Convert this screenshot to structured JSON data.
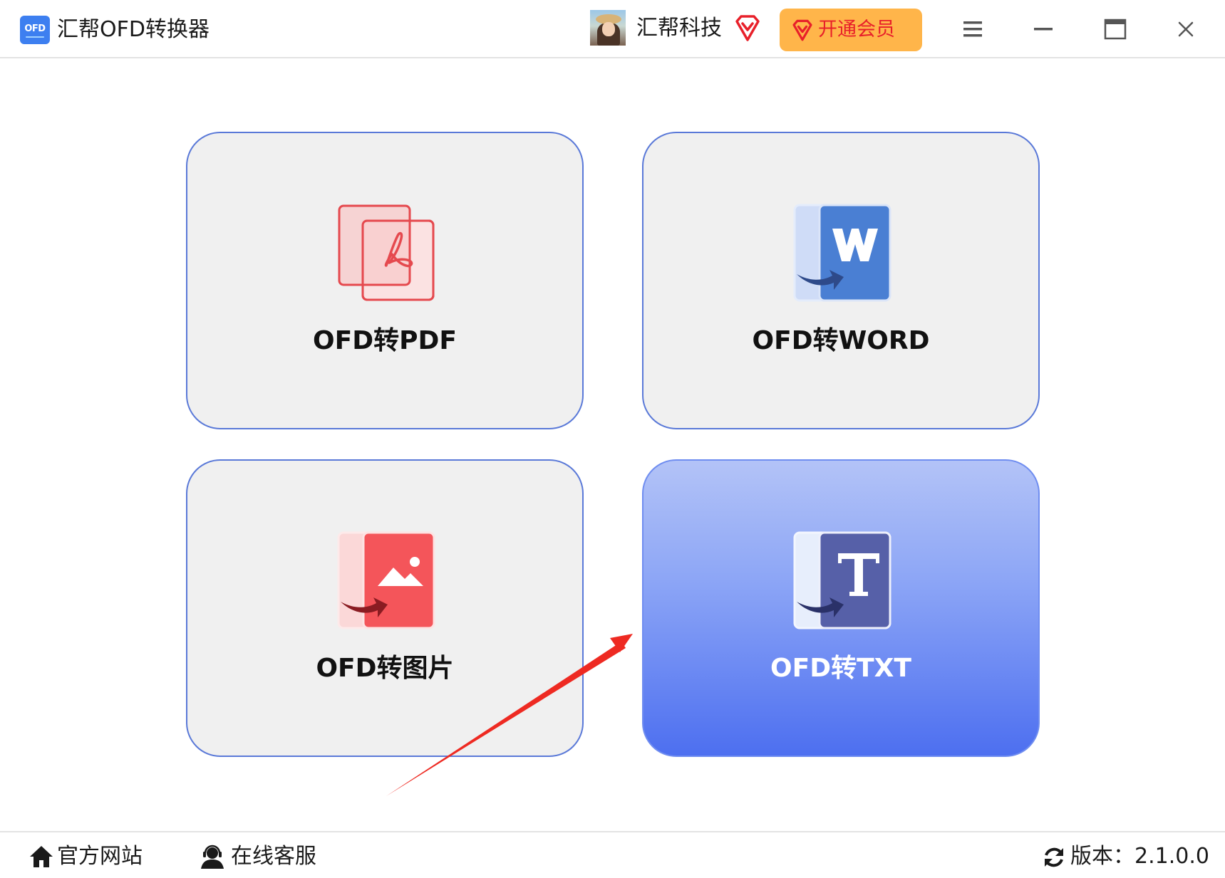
{
  "window": {
    "logo_text": "OFD",
    "title": "汇帮OFD转换器"
  },
  "account": {
    "company": "汇帮科技",
    "vip_button_label": "开通会员"
  },
  "cards": [
    {
      "label": "OFD转PDF",
      "icon": "pdf-icon",
      "selected": false
    },
    {
      "label": "OFD转WORD",
      "icon": "word-icon",
      "selected": false
    },
    {
      "label": "OFD转图片",
      "icon": "image-icon",
      "selected": false
    },
    {
      "label": "OFD转TXT",
      "icon": "txt-icon",
      "selected": true
    }
  ],
  "footer": {
    "website": "官方网站",
    "support": "在线客服",
    "version": "版本：2.1.0.0"
  },
  "colors": {
    "accent": "#4d6ff0",
    "card_border": "#5a79d8",
    "card_bg": "#f0f0f0",
    "vip_bg": "#ffb54a",
    "vip_text": "#e8202a",
    "annotation_arrow": "#ee2a22"
  }
}
